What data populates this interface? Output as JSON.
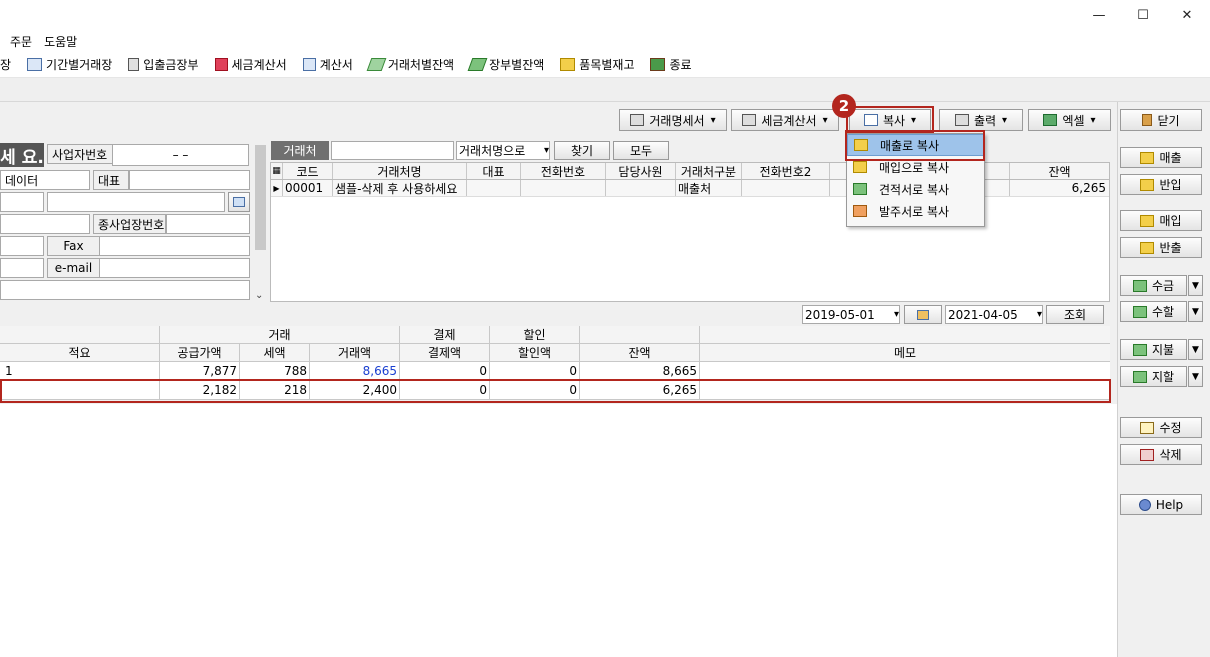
{
  "window": {
    "minimize": "—",
    "maximize": "☐",
    "close": "✕"
  },
  "menu": [
    "주문",
    "도움말"
  ],
  "toolbar": [
    {
      "label": "장",
      "icon": "none"
    },
    {
      "label": "기간별거래장",
      "icon": "ledger-icon"
    },
    {
      "label": "입출금장부",
      "icon": "calculator-icon"
    },
    {
      "label": "세금계산서",
      "icon": "tax-invoice-icon"
    },
    {
      "label": "계산서",
      "icon": "invoice-icon"
    },
    {
      "label": "거래처별잔액",
      "icon": "money-icon"
    },
    {
      "label": "장부별잔액",
      "icon": "money-icon"
    },
    {
      "label": "품목별재고",
      "icon": "box-icon"
    },
    {
      "label": "종료",
      "icon": "exit-icon"
    }
  ],
  "actionbar": {
    "statement": "거래명세서",
    "taxinvoice": "세금계산서",
    "copy": "복사",
    "print": "출력",
    "excel": "엑셀",
    "close": "닫기"
  },
  "badge": "2",
  "copy_menu": [
    "매출로 복사",
    "매입으로 복사",
    "견적서로 복사",
    "발주서로 복사"
  ],
  "left_form": {
    "title_fragment": "세 요.",
    "biz_no_label": "사업자번호",
    "biz_no_value": "–    –",
    "data_label": "데이터",
    "rep_label": "대표",
    "branch_label": "종사업장번호",
    "fax_label": "Fax",
    "email_label": "e-mail"
  },
  "search": {
    "label": "거래처",
    "mode": "거래처명으로",
    "find": "찾기",
    "all": "모두"
  },
  "client_grid": {
    "headers": [
      "코드",
      "거래처명",
      "대표",
      "전화번호",
      "담당사원",
      "거래처구분",
      "전화번호2",
      "잔액"
    ],
    "rows": [
      {
        "code": "00001",
        "name": "샘플-삭제 후 사용하세요",
        "rep": "",
        "phone": "",
        "staff": "",
        "kind": "매출처",
        "phone2": "",
        "balance": "6,265"
      }
    ]
  },
  "period": {
    "from": "2019-05-01",
    "to": "2021-04-05",
    "query": "조회"
  },
  "ledger": {
    "group_headers": {
      "trade": "거래",
      "settle": "결제",
      "discount": "할인"
    },
    "headers": {
      "memo_col": "적요",
      "supply": "공급가액",
      "tax": "세액",
      "amount": "거래액",
      "settle": "결제액",
      "discount": "할인액",
      "balance": "잔액",
      "memo": "메모"
    },
    "rows": [
      {
        "memo_col": "1",
        "supply": "7,877",
        "tax": "788",
        "amount": "8,665",
        "settle": "0",
        "discount": "0",
        "balance": "8,665",
        "memo": ""
      },
      {
        "memo_col": "",
        "supply": "2,182",
        "tax": "218",
        "amount": "2,400",
        "settle": "0",
        "discount": "0",
        "balance": "6,265",
        "memo": ""
      }
    ]
  },
  "right_buttons": {
    "sale": "매출",
    "sale_return": "반입",
    "purchase": "매입",
    "purchase_return": "반출",
    "receive": "수금",
    "receive_discount": "수할",
    "pay": "지불",
    "pay_discount": "지할",
    "edit": "수정",
    "delete": "삭제",
    "help": "Help"
  },
  "colors": {
    "highlight_red": "#b3261e",
    "menu_highlight": "#9ec3ea",
    "link_blue": "#1a3fd0"
  }
}
